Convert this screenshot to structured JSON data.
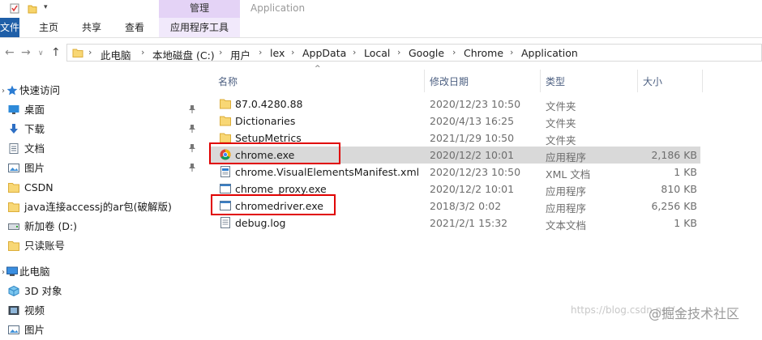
{
  "ribbon": {
    "contextual_tab": "管理",
    "window_title": "Application",
    "tabs": [
      "文件",
      "主页",
      "共享",
      "查看",
      "应用程序工具"
    ]
  },
  "address": {
    "crumbs": [
      "此电脑",
      "本地磁盘 (C:)",
      "用户",
      "lex",
      "AppData",
      "Local",
      "Google",
      "Chrome",
      "Application"
    ]
  },
  "sidebar": {
    "items": [
      {
        "label": "快速访问",
        "icon": "star-icon"
      },
      {
        "label": "桌面",
        "icon": "desktop-icon"
      },
      {
        "label": "下载",
        "icon": "download-icon"
      },
      {
        "label": "文档",
        "icon": "document-icon"
      },
      {
        "label": "图片",
        "icon": "picture-icon"
      },
      {
        "label": "CSDN",
        "icon": "folder-icon"
      },
      {
        "label": "java连接accessj的ar包(破解版)",
        "icon": "folder-icon"
      },
      {
        "label": "新加卷 (D:)",
        "icon": "drive-icon"
      },
      {
        "label": "只读账号",
        "icon": "folder-icon"
      },
      {
        "label": "此电脑",
        "icon": "computer-icon"
      },
      {
        "label": "3D 对象",
        "icon": "3d-objects-icon"
      },
      {
        "label": "视频",
        "icon": "video-icon"
      },
      {
        "label": "图片",
        "icon": "picture-icon"
      }
    ]
  },
  "columns": {
    "name": "名称",
    "date": "修改日期",
    "type": "类型",
    "size": "大小"
  },
  "files": [
    {
      "name": "87.0.4280.88",
      "date": "2020/12/23 10:50",
      "type": "文件夹",
      "size": "",
      "icon": "folder-icon"
    },
    {
      "name": "Dictionaries",
      "date": "2020/4/13 16:25",
      "type": "文件夹",
      "size": "",
      "icon": "folder-icon"
    },
    {
      "name": "SetupMetrics",
      "date": "2021/1/29 10:50",
      "type": "文件夹",
      "size": "",
      "icon": "folder-icon"
    },
    {
      "name": "chrome.exe",
      "date": "2020/12/2 10:01",
      "type": "应用程序",
      "size": "2,186 KB",
      "icon": "chrome-icon"
    },
    {
      "name": "chrome.VisualElementsManifest.xml",
      "date": "2020/12/23 10:50",
      "type": "XML 文档",
      "size": "1 KB",
      "icon": "xml-file-icon"
    },
    {
      "name": "chrome_proxy.exe",
      "date": "2020/12/2 10:01",
      "type": "应用程序",
      "size": "810 KB",
      "icon": "exe-icon"
    },
    {
      "name": "chromedriver.exe",
      "date": "2018/3/2 0:02",
      "type": "应用程序",
      "size": "6,256 KB",
      "icon": "exe-icon"
    },
    {
      "name": "debug.log",
      "date": "2021/2/1 15:32",
      "type": "文本文档",
      "size": "1 KB",
      "icon": "text-file-icon"
    }
  ],
  "watermark": "https://blog.csdn.net/...",
  "watermark_brand": "@掘金技术社区",
  "colors": {
    "file_tab": "#1f5fa8",
    "manage_tab": "#e4d3f6",
    "highlight_box": "#e00000",
    "selected_row": "#d9d9d9"
  }
}
